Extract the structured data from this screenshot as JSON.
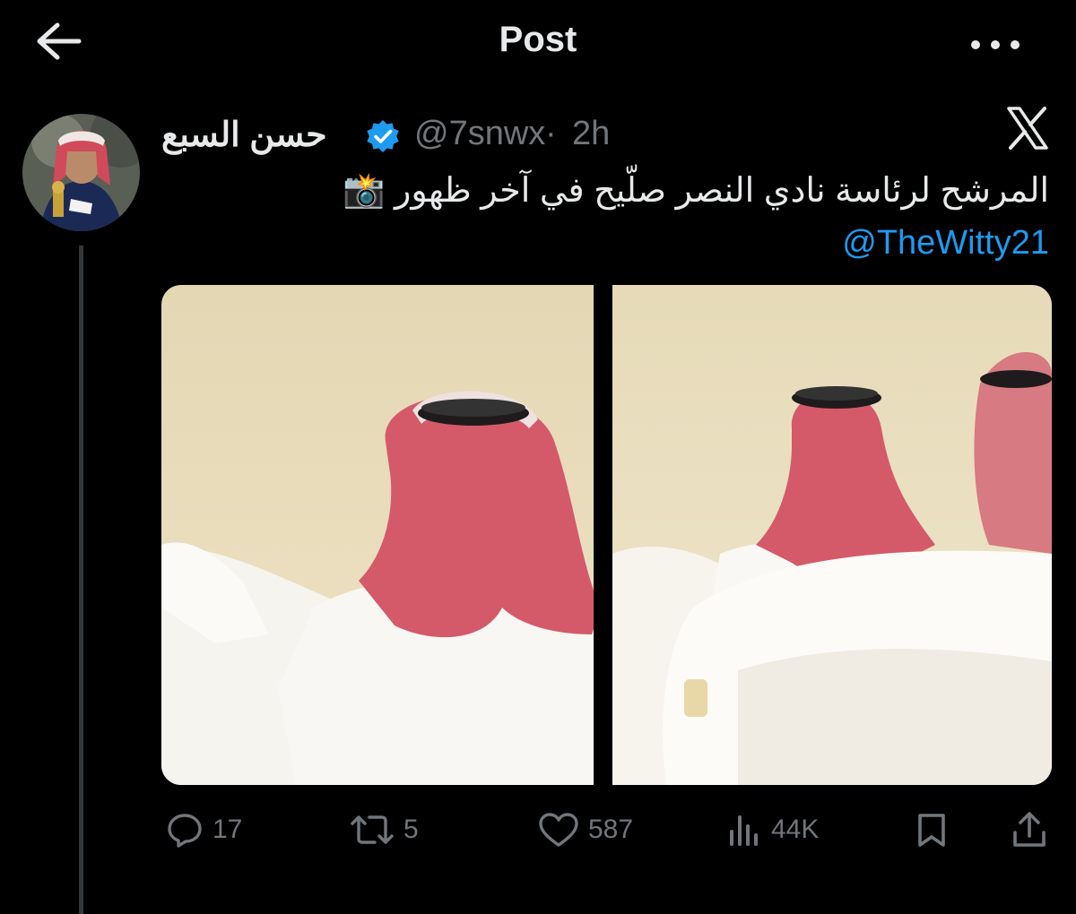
{
  "header": {
    "title": "Post"
  },
  "tweet": {
    "author_name": "حسن السبع",
    "handle": "@7snwx",
    "separator": "·",
    "time": "2h",
    "text": "المرشح لرئاسة نادي النصر صلّيح في آخر ظهور 📸",
    "mention": "@TheWitty21"
  },
  "actions": {
    "replies": "17",
    "reposts": "5",
    "likes": "587",
    "views": "44K"
  },
  "colors": {
    "background": "#000000",
    "text": "#e7e9ea",
    "muted": "#71767b",
    "link": "#1d9bf0",
    "verified": "#1d9bf0"
  },
  "icons": [
    "back-arrow-icon",
    "more-icon",
    "verified-badge-icon",
    "x-logo-icon",
    "reply-icon",
    "repost-icon",
    "like-icon",
    "views-icon",
    "bookmark-icon",
    "share-icon"
  ]
}
